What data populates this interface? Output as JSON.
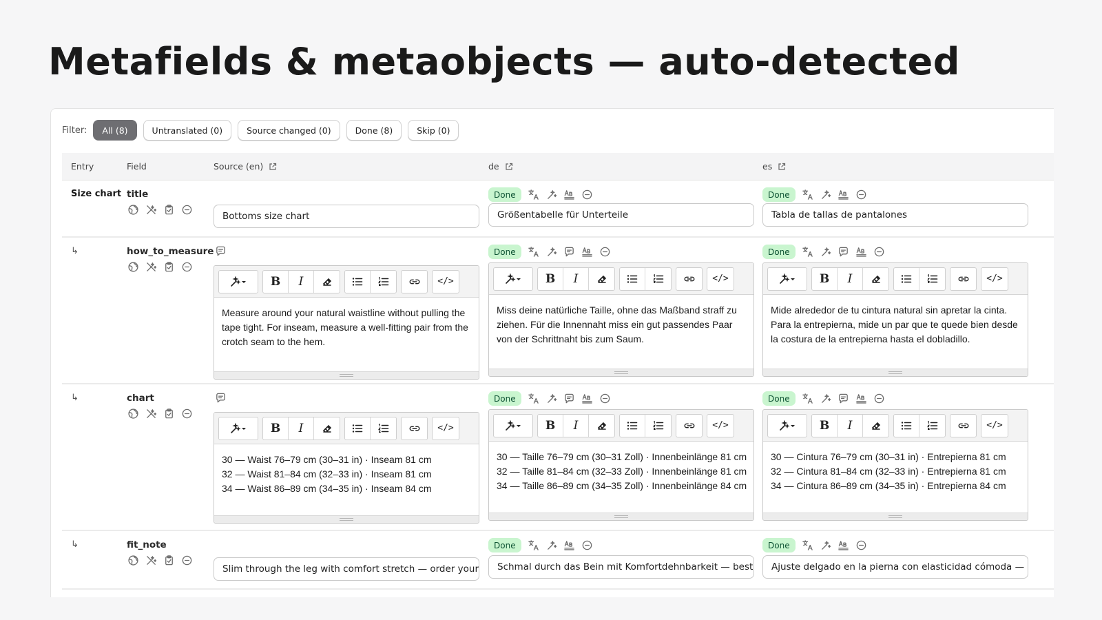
{
  "page": {
    "title": "Metafields & metaobjects — auto-detected"
  },
  "filters": {
    "label": "Filter:",
    "chips": [
      "All (8)",
      "Untranslated (0)",
      "Source changed (0)",
      "Done (8)",
      "Skip (0)"
    ],
    "active": "All (8)"
  },
  "table": {
    "headers": {
      "entry": "Entry",
      "field": "Field",
      "source": "Source (en)",
      "de": "de",
      "es": "es"
    }
  },
  "rows": [
    {
      "entry": "Size chart",
      "field": "title",
      "type": "text",
      "source": "Bottoms size chart",
      "de": {
        "status": "Done",
        "value": "Größentabelle für Unterteile"
      },
      "es": {
        "status": "Done",
        "value": "Tabla de tallas de pantalones"
      }
    },
    {
      "entry": "↳",
      "field": "how_to_measure",
      "type": "richtext",
      "source": "Measure around your natural waistline without pulling the tape tight. For inseam, measure a well-fitting pair from the crotch seam to the hem.",
      "de": {
        "status": "Done",
        "value": "Miss deine natürliche Taille, ohne das Maßband straff zu ziehen. Für die Innennaht miss ein gut passendes Paar von der Schrittnaht bis zum Saum."
      },
      "es": {
        "status": "Done",
        "value": "Mide alrededor de tu cintura natural sin apretar la cinta. Para la entrepierna, mide un par que te quede bien desde la costura de la entrepierna hasta el dobladillo."
      }
    },
    {
      "entry": "↳",
      "field": "chart",
      "type": "richtext",
      "source_lines": [
        "30 — Waist 76–79 cm (30–31 in) · Inseam 81 cm",
        "32 — Waist 81–84 cm (32–33 in) · Inseam 81 cm",
        "34 — Waist 86–89 cm (34–35 in) · Inseam 84 cm"
      ],
      "de": {
        "status": "Done",
        "lines": [
          "30 — Taille 76–79 cm (30–31 Zoll) · Innenbeinlänge 81 cm",
          "32 — Taille 81–84 cm (32–33 Zoll) · Innenbeinlänge 81 cm",
          "34 — Taille 86–89 cm (34–35 Zoll) · Innenbeinlänge 84 cm"
        ]
      },
      "es": {
        "status": "Done",
        "lines": [
          "30 — Cintura 76–79 cm (30–31 in) · Entrepierna 81 cm",
          "32 — Cintura 81–84 cm (32–33 in) · Entrepierna 81 cm",
          "34 — Cintura 86–89 cm (34–35 in) · Entrepierna 84 cm"
        ]
      }
    },
    {
      "entry": "↳",
      "field": "fit_note",
      "type": "text",
      "source": "Slim through the leg with comfort stretch — order your",
      "de": {
        "status": "Done",
        "value": "Schmal durch das Bein mit Komfortdehnbarkeit — best"
      },
      "es": {
        "status": "Done",
        "value": "Ajuste delgado en la pierna con elasticidad cómoda —"
      }
    }
  ],
  "toolbar": {
    "code_label": "</>"
  },
  "icons": {
    "field_actions": [
      "globe-icon",
      "magic-wand-icon",
      "clipboard-icon",
      "minus-circle-icon"
    ],
    "column_actions": [
      "translate-icon",
      "sparkle-icon",
      "comment-icon",
      "spellcheck-icon",
      "minus-circle-icon"
    ],
    "editor_tools": [
      "magic-dropdown-icon",
      "bold-icon",
      "italic-icon",
      "eraser-icon",
      "bullet-list-icon",
      "numbered-list-icon",
      "link-icon",
      "code-icon"
    ]
  }
}
